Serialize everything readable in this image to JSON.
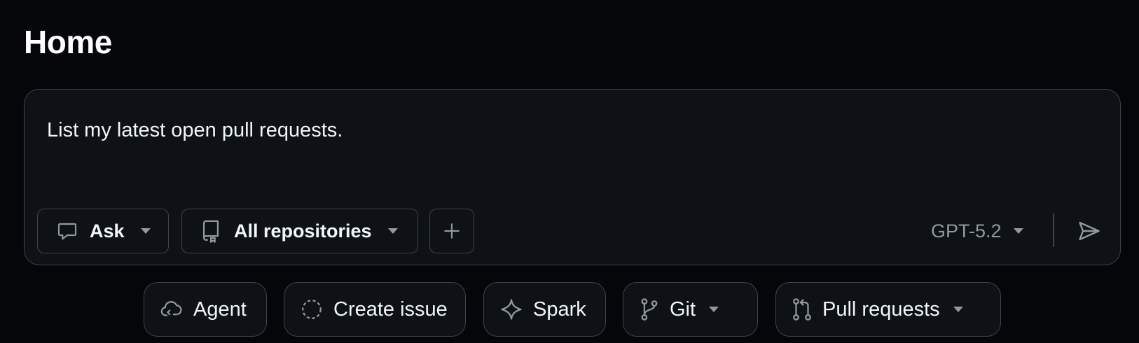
{
  "page": {
    "title": "Home"
  },
  "composer": {
    "prompt_value": "List my latest open pull requests.",
    "mode": {
      "label": "Ask",
      "icon": "comment-icon"
    },
    "repository": {
      "label": "All repositories",
      "icon": "repo-icon"
    },
    "add": {
      "icon": "plus-icon"
    },
    "model": {
      "label": "GPT-5.2"
    },
    "send": {
      "icon": "paper-airplane-icon"
    }
  },
  "suggestions": [
    {
      "label": "Agent",
      "icon": "cloud-agent-icon",
      "has_dropdown": false
    },
    {
      "label": "Create issue",
      "icon": "issue-circle-icon",
      "has_dropdown": false
    },
    {
      "label": "Spark",
      "icon": "sparkle-icon",
      "has_dropdown": false
    },
    {
      "label": "Git",
      "icon": "git-branch-icon",
      "has_dropdown": true
    },
    {
      "label": "Pull requests",
      "icon": "git-pull-request-icon",
      "has_dropdown": true
    }
  ],
  "colors": {
    "background": "#05060a",
    "surface": "#0e1116",
    "border": "#3d444d",
    "text": "#f0f6fc",
    "muted": "#9198a1"
  }
}
